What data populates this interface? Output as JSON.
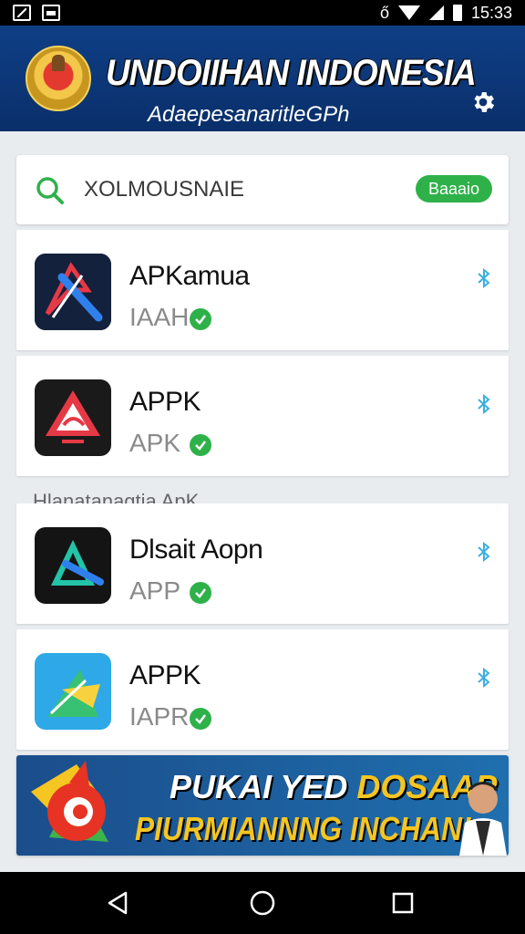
{
  "status_bar": {
    "time": "15:33",
    "alarm": "ő"
  },
  "header": {
    "title": "UNDOIIHAN INDONESIA",
    "subtitle": "AdaepesanaritleGPh"
  },
  "search": {
    "placeholder": "XOLMOUSNAIE",
    "button_label": "Baaaio"
  },
  "apps": [
    {
      "name": "APKamua",
      "sub": "IAAH"
    },
    {
      "name": "APPK",
      "sub": "APK"
    },
    {
      "name": "Dlsait Aopn",
      "sub": "APP"
    },
    {
      "name": "APPK",
      "sub": "IAPR"
    }
  ],
  "section_label": "Hlanatanagtia ApK",
  "banner": {
    "line1_a": "PUKAI YED ",
    "line1_b": "DOSAAP",
    "line2": "PIURMIANNNG INCHAN!"
  },
  "colors": {
    "header_bg": "#0f3f86",
    "accent_green": "#2fb14a",
    "share_blue": "#3ab0e0",
    "banner_yellow": "#f5c521"
  }
}
